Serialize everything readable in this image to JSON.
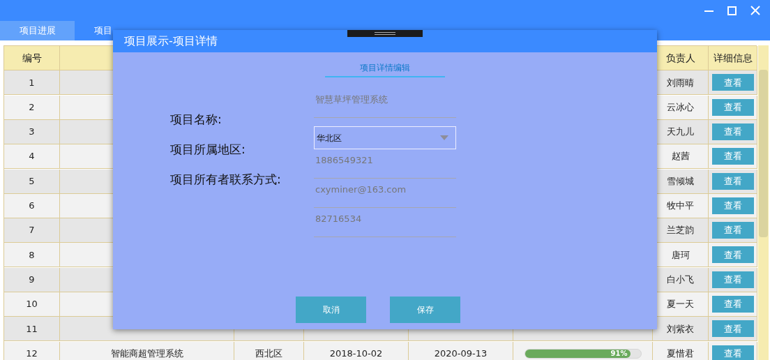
{
  "tabs": [
    {
      "label": "项目进展",
      "selected": true
    },
    {
      "label": "项目",
      "selected": false
    }
  ],
  "table": {
    "columns": [
      {
        "label": "编号"
      },
      {
        "label": "负责人"
      },
      {
        "label": "详细信息"
      }
    ],
    "rows": [
      {
        "number": "1",
        "owner": "刘雨晴",
        "action": "查看"
      },
      {
        "number": "2",
        "owner": "云冰心",
        "action": "查看"
      },
      {
        "number": "3",
        "owner": "天九儿",
        "action": "查看"
      },
      {
        "number": "4",
        "owner": "赵茜",
        "action": "查看"
      },
      {
        "number": "5",
        "owner": "雪倾城",
        "action": "查看"
      },
      {
        "number": "6",
        "owner": "牧中平",
        "action": "查看"
      },
      {
        "number": "7",
        "owner": "兰芝韵",
        "action": "查看"
      },
      {
        "number": "8",
        "owner": "唐珂",
        "action": "查看"
      },
      {
        "number": "9",
        "owner": "白小飞",
        "action": "查看"
      },
      {
        "number": "10",
        "owner": "夏一天",
        "action": "查看"
      },
      {
        "number": "11",
        "owner": "刘紫衣",
        "action": "查看"
      },
      {
        "number": "12",
        "project": "智能商超管理系统",
        "region": "西北区",
        "start": "2018-10-02",
        "end": "2020-09-13",
        "progress": {
          "level": 0.91,
          "label": "91%"
        },
        "owner": "夏惜君",
        "action": "查看"
      }
    ]
  },
  "dialog": {
    "title": "项目展示-项目详情",
    "tab": {
      "label": "项目详情编辑",
      "selected": true
    },
    "labels": [
      "项目名称:",
      "项目所属地区:",
      "项目所有者联系方式:"
    ],
    "fields": [
      {
        "kind": "text",
        "value": "智慧草坪管理系统"
      },
      {
        "kind": "select",
        "value": "华北区"
      },
      {
        "kind": "text",
        "value": "1886549321"
      },
      {
        "kind": "text",
        "value": "cxyminer@163.com"
      },
      {
        "kind": "text",
        "value": "82716534"
      }
    ],
    "buttons": [
      "取消",
      "保存"
    ]
  }
}
